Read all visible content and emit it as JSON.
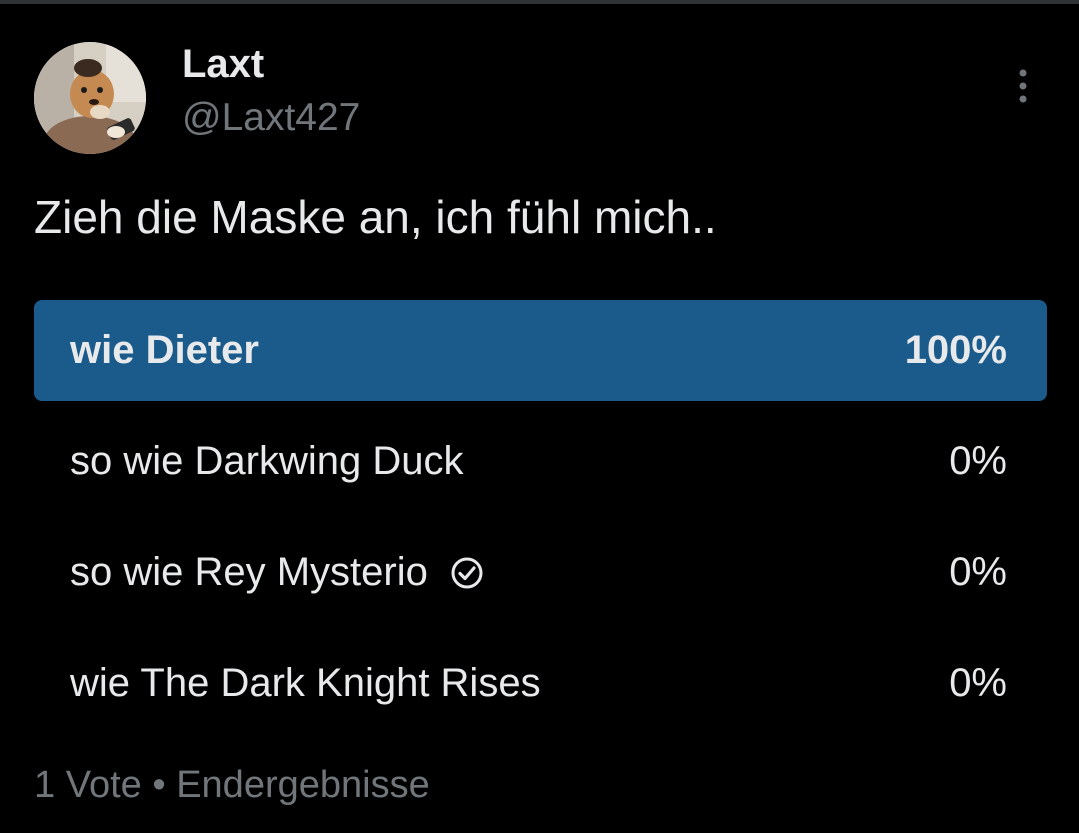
{
  "author": {
    "display_name": "Laxt",
    "handle": "@Laxt427",
    "avatar_icon": "dog-avatar-icon"
  },
  "tweet": {
    "text": "Zieh die Maske an, ich fühl mich.."
  },
  "poll": {
    "options": [
      {
        "label": "wie Dieter",
        "percent_text": "100%",
        "share": 1.0,
        "winner": true,
        "selected_by_user": false
      },
      {
        "label": "so wie Darkwing Duck",
        "percent_text": "0%",
        "share": 0.0,
        "winner": false,
        "selected_by_user": false
      },
      {
        "label": "so wie Rey Mysterio",
        "percent_text": "0%",
        "share": 0.0,
        "winner": false,
        "selected_by_user": true
      },
      {
        "label": "wie The Dark Knight Rises",
        "percent_text": "0%",
        "share": 0.0,
        "winner": false,
        "selected_by_user": false
      }
    ],
    "footer": {
      "votes": "1 Vote",
      "separator": "•",
      "status": "Endergebnisse"
    }
  },
  "icons": {
    "more": "more-vertical-icon",
    "check": "check-circle-icon"
  },
  "colors": {
    "background": "#000000",
    "text_primary": "#e7e9ea",
    "text_secondary": "#71767b",
    "poll_winner_fill": "#1a5b8c"
  }
}
